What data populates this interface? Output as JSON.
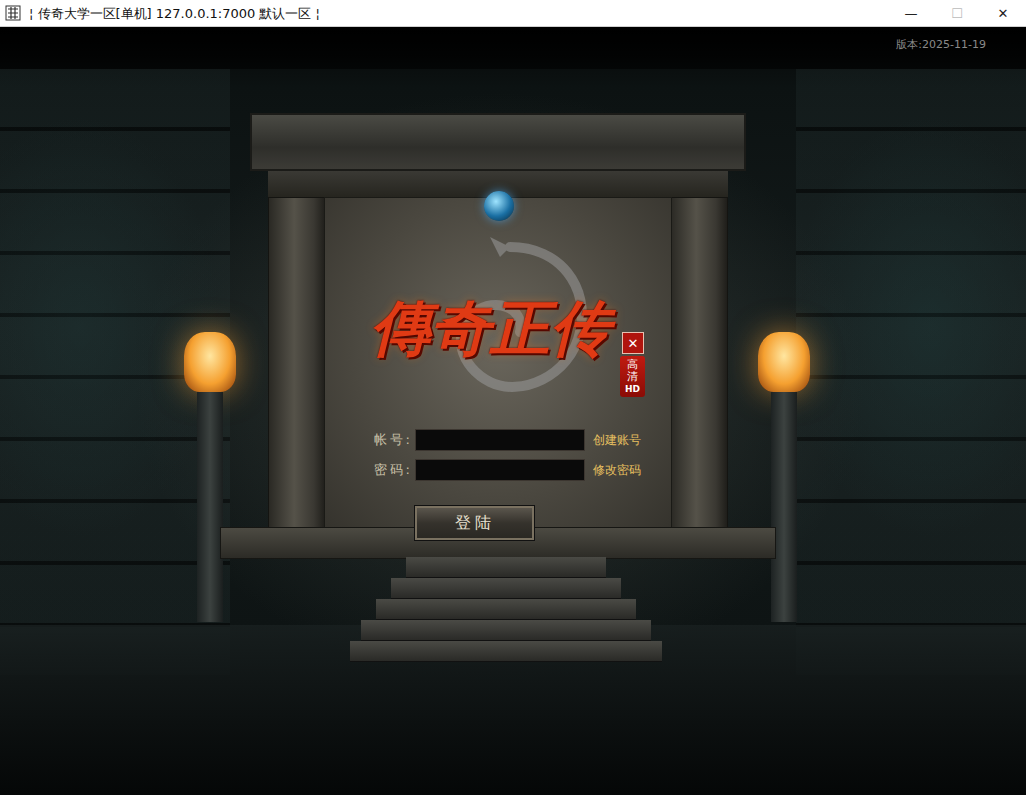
{
  "window": {
    "title": "¦ 传奇大学一区[单机] 127.0.0.1:7000  默认一区 ¦",
    "controls": [
      {
        "glyph": "—",
        "disabled": false
      },
      {
        "glyph": "☐",
        "disabled": true
      },
      {
        "glyph": "✕",
        "disabled": false
      }
    ]
  },
  "version": "版本:2025-11-19",
  "logo": {
    "text": "傳奇正传",
    "close": "✕",
    "badge_top": "高清",
    "badge_bottom": "HD"
  },
  "form": {
    "account": {
      "label": "帐号:",
      "value": ""
    },
    "password": {
      "label": "密码:",
      "value": ""
    },
    "create_link": "创建账号",
    "change_link": "修改密码",
    "login_button": "登陆"
  }
}
